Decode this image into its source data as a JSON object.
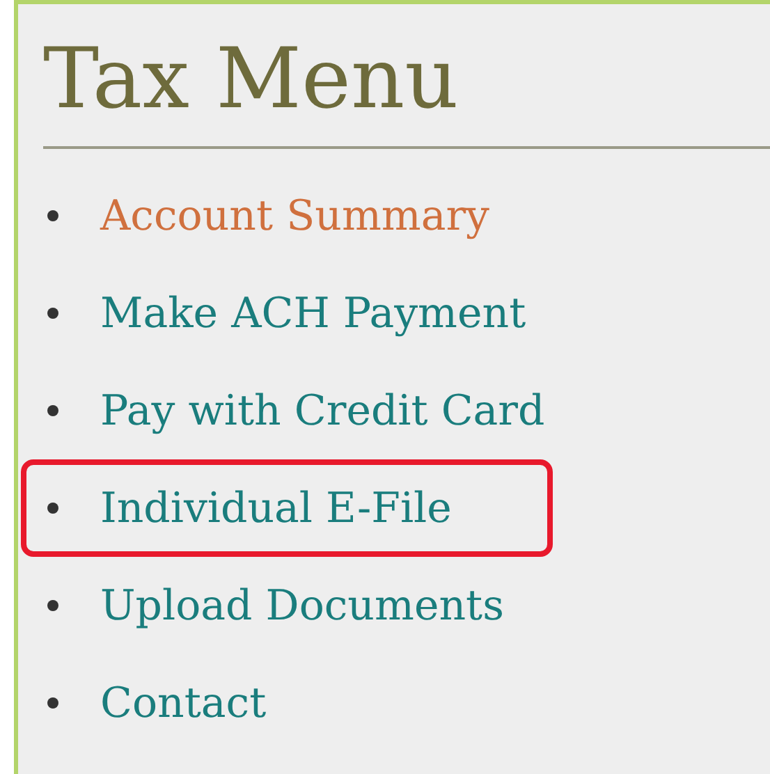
{
  "title": "Tax Menu",
  "items": [
    {
      "label": "Account Summary",
      "selected": true,
      "highlighted": false
    },
    {
      "label": "Make ACH Payment",
      "selected": false,
      "highlighted": false
    },
    {
      "label": "Pay with Credit Card",
      "selected": false,
      "highlighted": false
    },
    {
      "label": "Individual E-File",
      "selected": false,
      "highlighted": true
    },
    {
      "label": "Upload Documents",
      "selected": false,
      "highlighted": false
    },
    {
      "label": "Contact",
      "selected": false,
      "highlighted": false
    }
  ]
}
